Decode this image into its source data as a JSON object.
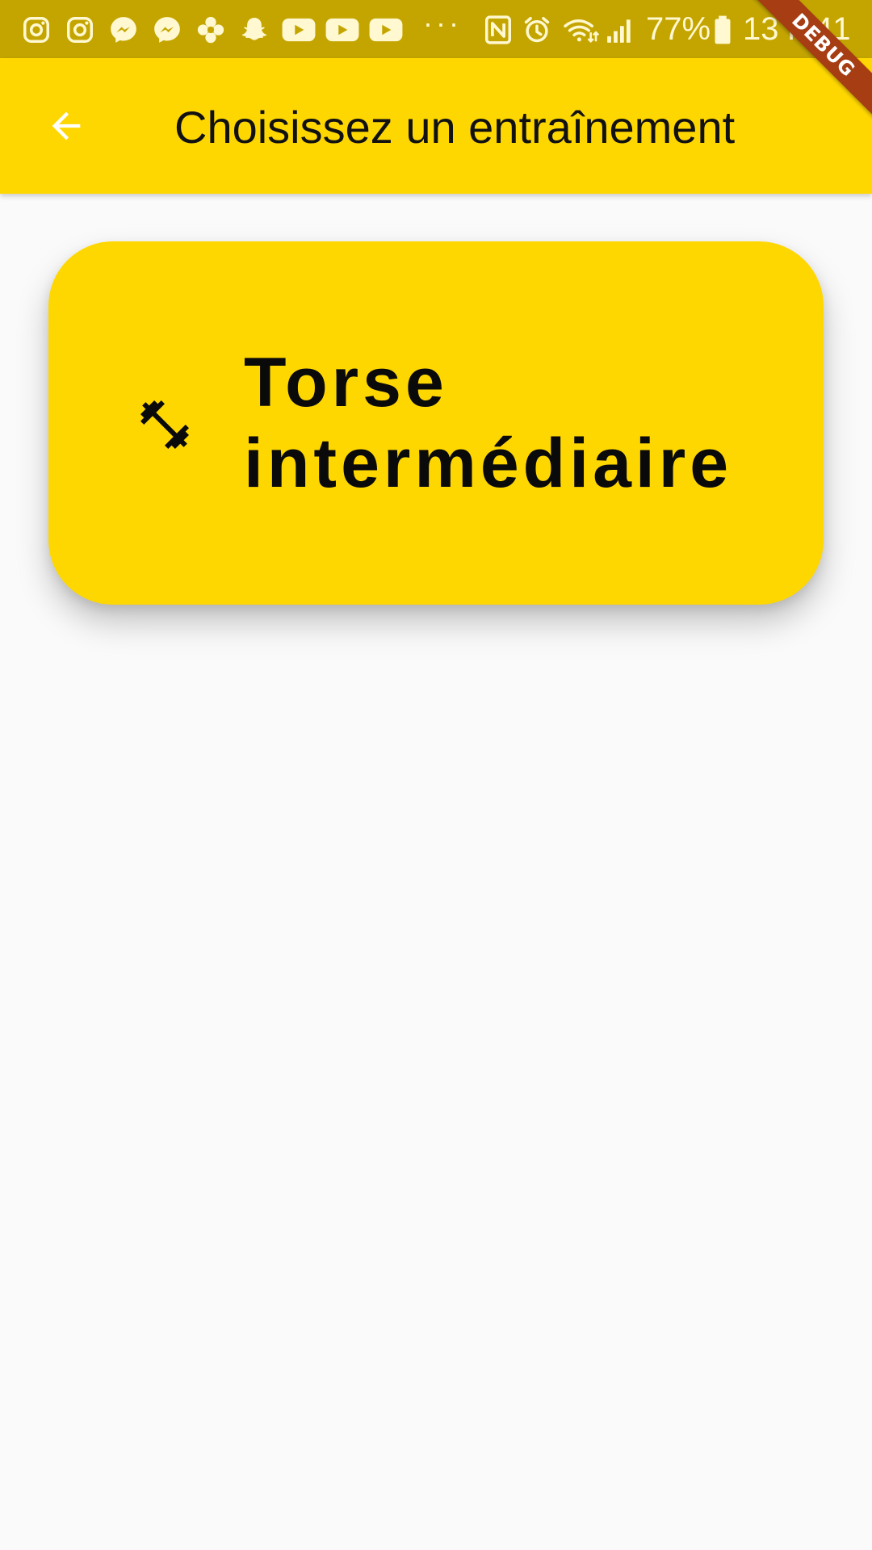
{
  "status_bar": {
    "battery_percent": "77%",
    "time": "13 h 41",
    "overflow": "···",
    "notification_icons": [
      "instagram-icon",
      "instagram-icon",
      "messenger-icon",
      "messenger-icon",
      "flower-icon",
      "snapchat-icon",
      "youtube-icon",
      "youtube-icon",
      "youtube-icon"
    ],
    "system_icons": [
      "nfc-icon",
      "alarm-icon",
      "wifi-icon",
      "signal-icon",
      "battery-icon"
    ]
  },
  "debug_banner": "DEBUG",
  "app_bar": {
    "title": "Choisissez un entraînement",
    "back_icon": "arrow-back-icon"
  },
  "workouts": [
    {
      "title": "Torse intermédiaire",
      "icon": "fitness-center-icon"
    }
  ],
  "colors": {
    "primary": "#ffd700",
    "status_bar": "#c4a500",
    "background": "#fafafa",
    "debug_ribbon": "#a63d13"
  }
}
